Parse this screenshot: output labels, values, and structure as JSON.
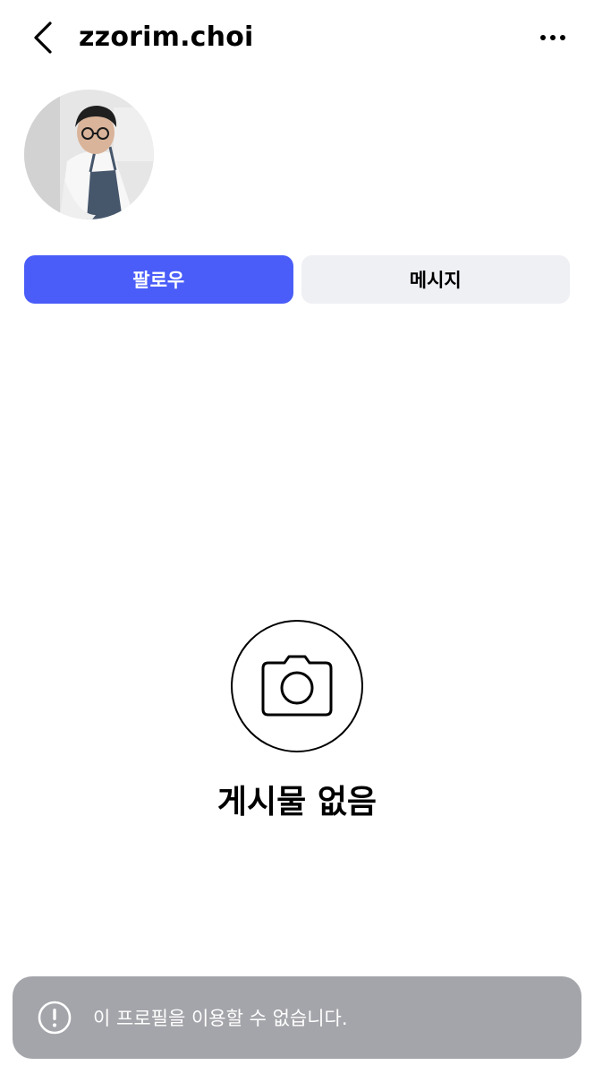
{
  "header": {
    "back_icon": "chevron-left-icon",
    "username": "zzorim.choi",
    "more_icon": "more-horizontal-icon"
  },
  "profile": {
    "avatar_alt": "profile photo"
  },
  "actions": {
    "follow_label": "팔로우",
    "message_label": "메시지"
  },
  "empty_state": {
    "icon": "camera-icon",
    "title": "게시물 없음"
  },
  "toast": {
    "icon": "alert-circle-icon",
    "message": "이 프로필을 이용할 수 없습니다."
  },
  "colors": {
    "follow_button": "#4a5df9",
    "message_button": "#eff0f4",
    "toast_background": "#a4a5aa"
  }
}
